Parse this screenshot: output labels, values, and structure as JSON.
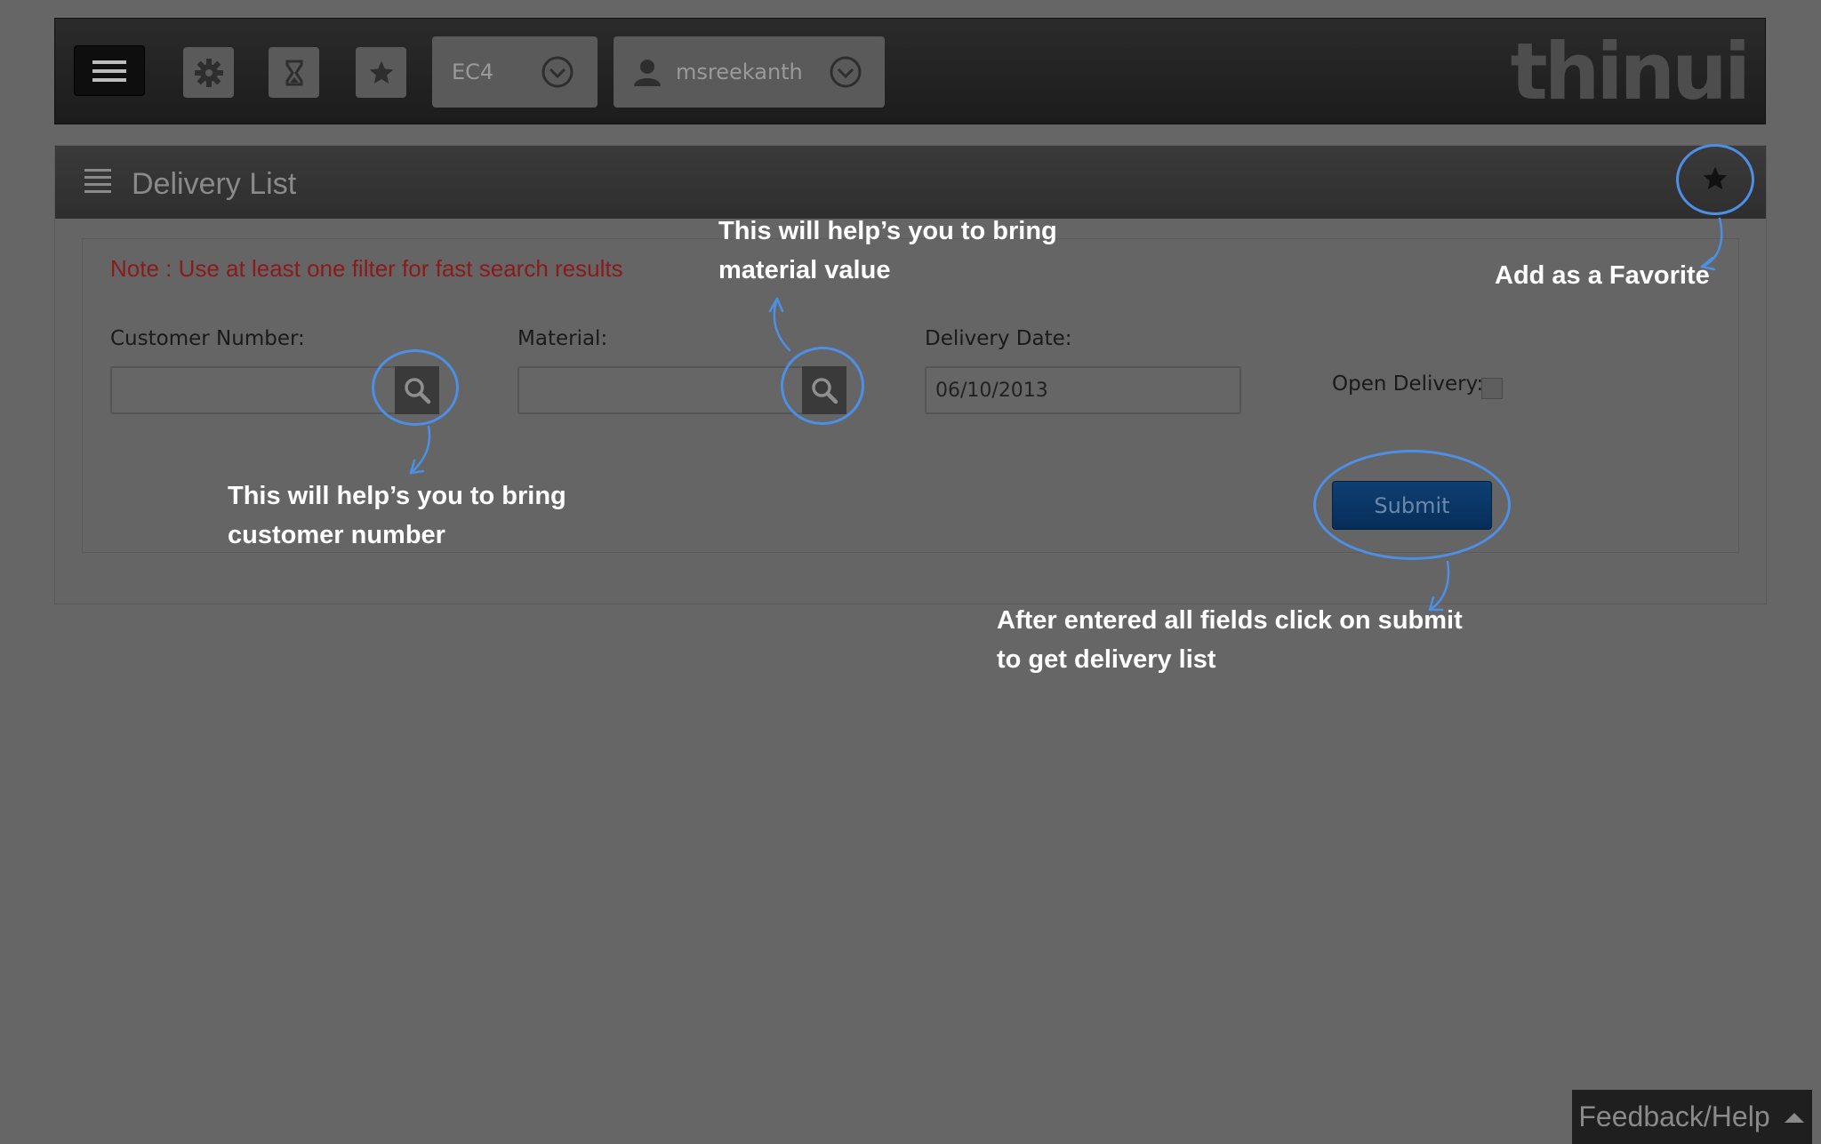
{
  "topbar": {
    "system": "EC4",
    "user": "msreekanth",
    "logo": "thinui"
  },
  "panel": {
    "title": "Delivery List"
  },
  "form": {
    "note": "Note : Use at least one filter for fast search results",
    "customer_label": "Customer Number:",
    "customer_value": "",
    "material_label": "Material:",
    "material_value": "",
    "date_label": "Delivery Date:",
    "date_value": "06/10/2013",
    "open_label": "Open Delivery:",
    "submit_label": "Submit"
  },
  "callouts": {
    "favorite": "Add as a Favorite",
    "material_line1": "This will help’s you to bring",
    "material_line2": "material value",
    "customer_line1": "This will help’s you to bring",
    "customer_line2": "customer number",
    "submit_line1": "After entered all fields click on submit",
    "submit_line2": "to get delivery list"
  },
  "footer": {
    "feedback": "Feedback/Help"
  },
  "colors": {
    "annotation": "#4e8fe6",
    "note": "#8b1a1a",
    "submit": "#0e3f73"
  }
}
